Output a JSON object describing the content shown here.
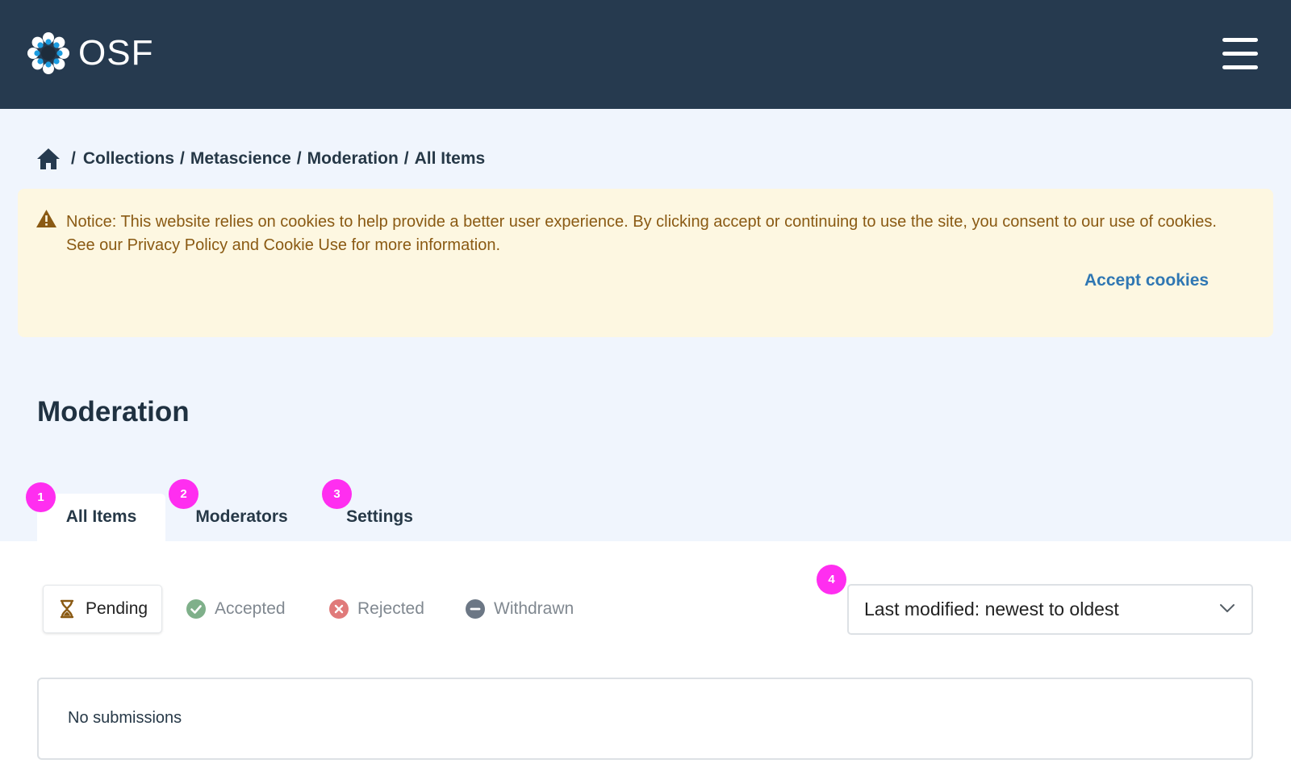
{
  "header": {
    "logo_text": "OSF",
    "logo_icon": "osf-flower-logo",
    "menu_icon": "hamburger-menu-icon",
    "background_color": "#263a4f"
  },
  "breadcrumb": {
    "home_icon": "home-icon",
    "separator": "/",
    "items": [
      "Collections",
      "Metascience",
      "Moderation",
      "All Items"
    ]
  },
  "cookie_notice": {
    "icon": "warning-icon",
    "text": "Notice: This website relies on cookies to help provide a better user experience. By clicking accept or continuing to use the site, you consent to our use of cookies. See our Privacy Policy and Cookie Use for more information.",
    "accept_label": "Accept cookies",
    "background_color": "#fdf7e1",
    "text_color": "#8a5a13",
    "link_color": "#2f77b3"
  },
  "page": {
    "title": "Moderation"
  },
  "tabs": [
    {
      "label": "All Items",
      "badge": "1",
      "active": true
    },
    {
      "label": "Moderators",
      "badge": "2",
      "active": false
    },
    {
      "label": "Settings",
      "badge": "3",
      "active": false
    }
  ],
  "status_filters": [
    {
      "label": "Pending",
      "icon": "hourglass-icon",
      "active": true
    },
    {
      "label": "Accepted",
      "icon": "check-circle-icon",
      "active": false,
      "color": "#7fb08a"
    },
    {
      "label": "Rejected",
      "icon": "x-circle-icon",
      "active": false,
      "color": "#e07a7a"
    },
    {
      "label": "Withdrawn",
      "icon": "minus-circle-icon",
      "active": false,
      "color": "#6c7785"
    }
  ],
  "sort": {
    "badge": "4",
    "selected": "Last modified: newest to oldest",
    "icon": "chevron-down-icon"
  },
  "results": {
    "empty_text": "No submissions"
  },
  "badge_color": "#ff2ef0"
}
